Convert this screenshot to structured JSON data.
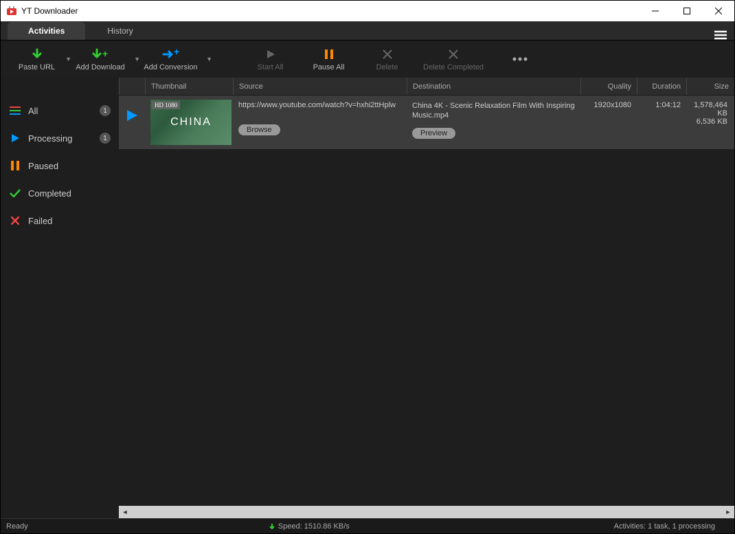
{
  "window": {
    "title": "YT Downloader"
  },
  "tabs": {
    "activities": "Activities",
    "history": "History"
  },
  "toolbar": {
    "paste_url": "Paste URL",
    "add_download": "Add Download",
    "add_conversion": "Add Conversion",
    "start_all": "Start All",
    "pause_all": "Pause All",
    "delete": "Delete",
    "delete_completed": "Delete Completed"
  },
  "sidebar": {
    "all": {
      "label": "All",
      "count": "1"
    },
    "processing": {
      "label": "Processing",
      "count": "1"
    },
    "paused": {
      "label": "Paused"
    },
    "completed": {
      "label": "Completed"
    },
    "failed": {
      "label": "Failed"
    }
  },
  "columns": {
    "thumbnail": "Thumbnail",
    "source": "Source",
    "destination": "Destination",
    "quality": "Quality",
    "duration": "Duration",
    "size": "Size"
  },
  "item": {
    "hd_badge": "HD 1080",
    "thumb_text": "CHINA",
    "source_url": "https://www.youtube.com/watch?v=hxhi2ttHplw",
    "browse_btn": "Browse",
    "destination_name": "China 4K - Scenic Relaxation Film With Inspiring Music.mp4",
    "preview_btn": "Preview",
    "quality": "1920x1080",
    "duration": "1:04:12",
    "size_total": "1,578,464 KB",
    "size_done": "6,536 KB"
  },
  "status": {
    "ready": "Ready",
    "speed": "Speed: 1510.86 KB/s",
    "activities": "Activities: 1 task, 1 processing"
  }
}
